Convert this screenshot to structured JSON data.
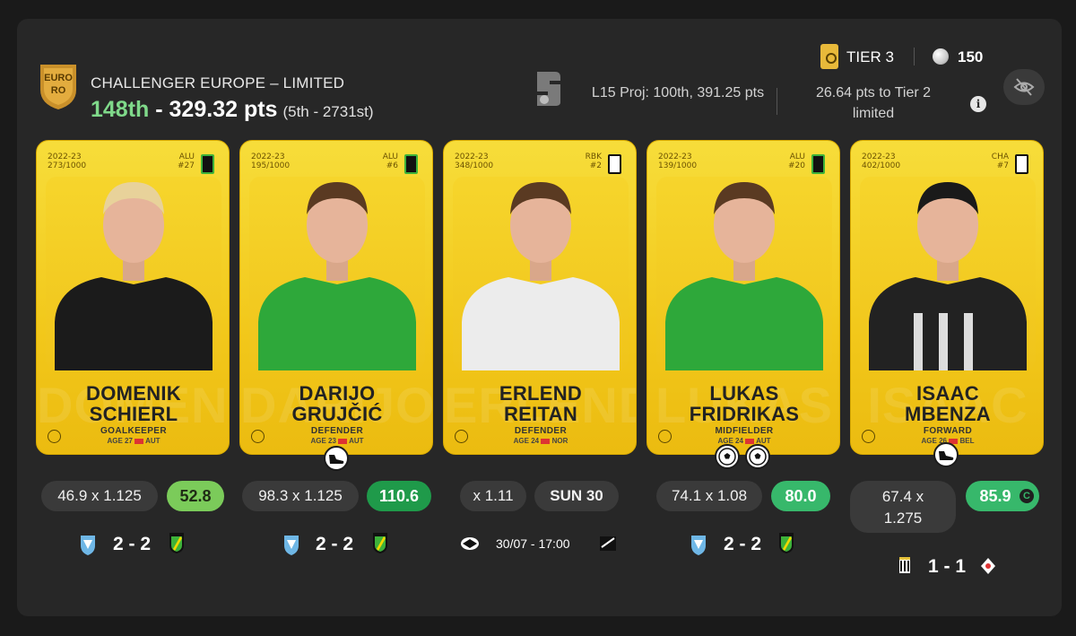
{
  "header": {
    "logo_text": "EURO",
    "competition": "CHALLENGER EUROPE – LIMITED",
    "rank": "148th",
    "separator": " - ",
    "points": "329.32 pts",
    "rank_range": "(5th - 2731st)",
    "projection": "L15 Proj: 100th, 391.25 pts",
    "to_next_tier": "26.64 pts to Tier 2 limited",
    "tier": "TIER 3",
    "coins": "150"
  },
  "colors": {
    "accent_green": "#7fd98a",
    "card_gold": "#f2c81b",
    "score_green": "#4caf50"
  },
  "cards": [
    {
      "season": "2022-23",
      "serial": "273/1000",
      "team": "ALU",
      "number": "#27",
      "first": "DOMENIK",
      "last": "SCHIERL",
      "position": "GOALKEEPER",
      "age": "AGE 27",
      "nation": "AUT",
      "ghost": "DOMENIK",
      "shirt": "black"
    },
    {
      "season": "2022-23",
      "serial": "195/1000",
      "team": "ALU",
      "number": "#6",
      "first": "DARIJO",
      "last": "GRUJČIĆ",
      "position": "DEFENDER",
      "age": "AGE 23",
      "nation": "AUT",
      "ghost": "DARIJO",
      "shirt": "green"
    },
    {
      "season": "2022-23",
      "serial": "348/1000",
      "team": "RBK",
      "number": "#2",
      "first": "ERLEND",
      "last": "REITAN",
      "position": "DEFENDER",
      "age": "AGE 24",
      "nation": "NOR",
      "ghost": "ERLEND",
      "shirt": "white"
    },
    {
      "season": "2022-23",
      "serial": "139/1000",
      "team": "ALU",
      "number": "#20",
      "first": "LUKAS",
      "last": "FRIDRIKAS",
      "position": "MIDFIELDER",
      "age": "AGE 24",
      "nation": "AUT",
      "ghost": "LUKAS",
      "shirt": "green"
    },
    {
      "season": "2022-23",
      "serial": "402/1000",
      "team": "CHA",
      "number": "#7",
      "first": "ISAAC",
      "last": "MBENZA",
      "position": "FORWARD",
      "age": "AGE 26",
      "nation": "BEL",
      "ghost": "ISAAC",
      "shirt": "stripes"
    }
  ],
  "stats": [
    {
      "calc": "46.9 x 1.125",
      "score": "52.8"
    },
    {
      "calc": "98.3 x 1.125",
      "score": "110.6"
    },
    {
      "calc": "x 1.11",
      "score": "SUN 30"
    },
    {
      "calc": "74.1 x 1.08",
      "score": "80.0"
    },
    {
      "calc_line1": "67.4 x",
      "calc_line2": "1.275",
      "score": "85.9"
    }
  ],
  "matches": [
    {
      "result": "2 - 2"
    },
    {
      "result": "2 - 2"
    },
    {
      "time": "30/07 - 17:00"
    },
    {
      "result": "2 - 2"
    },
    {
      "result": "1 - 1"
    }
  ]
}
